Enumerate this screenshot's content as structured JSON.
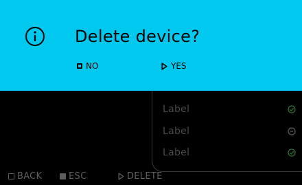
{
  "dialog": {
    "icon": "info-icon",
    "title": "Delete device?",
    "options": {
      "no_label": "NO",
      "no_icon": "square-outline-icon",
      "yes_label": "YES",
      "yes_icon": "triangle-outline-icon"
    },
    "background_color": "#00c8ee"
  },
  "list": {
    "items": [
      {
        "label": "Label",
        "status_icon": "check-circle-icon",
        "status_color": "#2e6e2e"
      },
      {
        "label": "Label",
        "status_icon": "minus-circle-icon",
        "status_color": "#5a5a5a"
      },
      {
        "label": "Label",
        "status_icon": "check-circle-icon",
        "status_color": "#2e6e2e"
      }
    ]
  },
  "footer": {
    "back_label": "BACK",
    "back_icon": "square-outline-icon",
    "esc_label": "ESC",
    "esc_icon": "square-filled-icon",
    "delete_label": "DELETE",
    "delete_icon": "triangle-outline-icon"
  }
}
